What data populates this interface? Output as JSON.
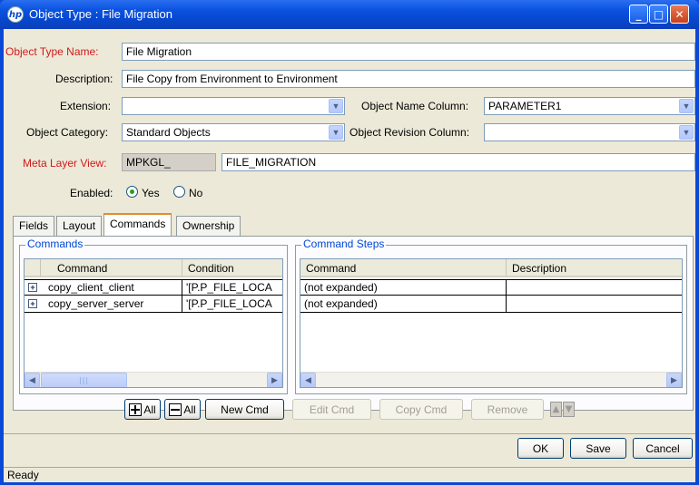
{
  "window": {
    "title": "Object Type : File Migration",
    "buttons": {
      "minimize": "_",
      "maximize": "□",
      "close": "✕"
    },
    "app_icon": "hp"
  },
  "form": {
    "object_type_name": {
      "label": "Object Type Name:",
      "value": "File Migration"
    },
    "description": {
      "label": "Description:",
      "value": "File Copy from Environment to Environment"
    },
    "extension": {
      "label": "Extension:",
      "value": ""
    },
    "object_name_column": {
      "label": "Object Name Column:",
      "value": "PARAMETER1"
    },
    "object_category": {
      "label": "Object Category:",
      "value": "Standard Objects"
    },
    "object_revision_column": {
      "label": "Object Revision Column:",
      "value": ""
    },
    "meta_layer_view": {
      "label": "Meta Layer View:",
      "prefix": "MPKGL_",
      "value": "FILE_MIGRATION"
    },
    "enabled": {
      "label": "Enabled:",
      "yes": "Yes",
      "no": "No",
      "selected": "Yes"
    }
  },
  "tabs": [
    {
      "label": "Fields",
      "active": false
    },
    {
      "label": "Layout",
      "active": false
    },
    {
      "label": "Commands",
      "active": true
    },
    {
      "label": "Ownership",
      "active": false
    }
  ],
  "commands": {
    "title": "Commands",
    "columns": [
      "Command",
      "Condition"
    ],
    "rows": [
      {
        "command": "copy_client_client",
        "condition": "'[P.P_FILE_LOCA"
      },
      {
        "command": "copy_server_server",
        "condition": "'[P.P_FILE_LOCA"
      }
    ]
  },
  "command_steps": {
    "title": "Command Steps",
    "columns": [
      "Command",
      "Description"
    ],
    "rows": [
      {
        "command": "(not expanded)",
        "description": ""
      },
      {
        "command": "(not expanded)",
        "description": ""
      }
    ]
  },
  "action_buttons": {
    "expand_all": "All",
    "collapse_all": "All",
    "new_cmd": "New Cmd",
    "edit_cmd": "Edit Cmd",
    "copy_cmd": "Copy Cmd",
    "remove": "Remove"
  },
  "dialog_buttons": {
    "ok": "OK",
    "save": "Save",
    "cancel": "Cancel"
  },
  "status": "Ready",
  "colors": {
    "required_label": "#d11a1a",
    "group_title": "#0046d5",
    "titlebar": "#0a52e0"
  }
}
